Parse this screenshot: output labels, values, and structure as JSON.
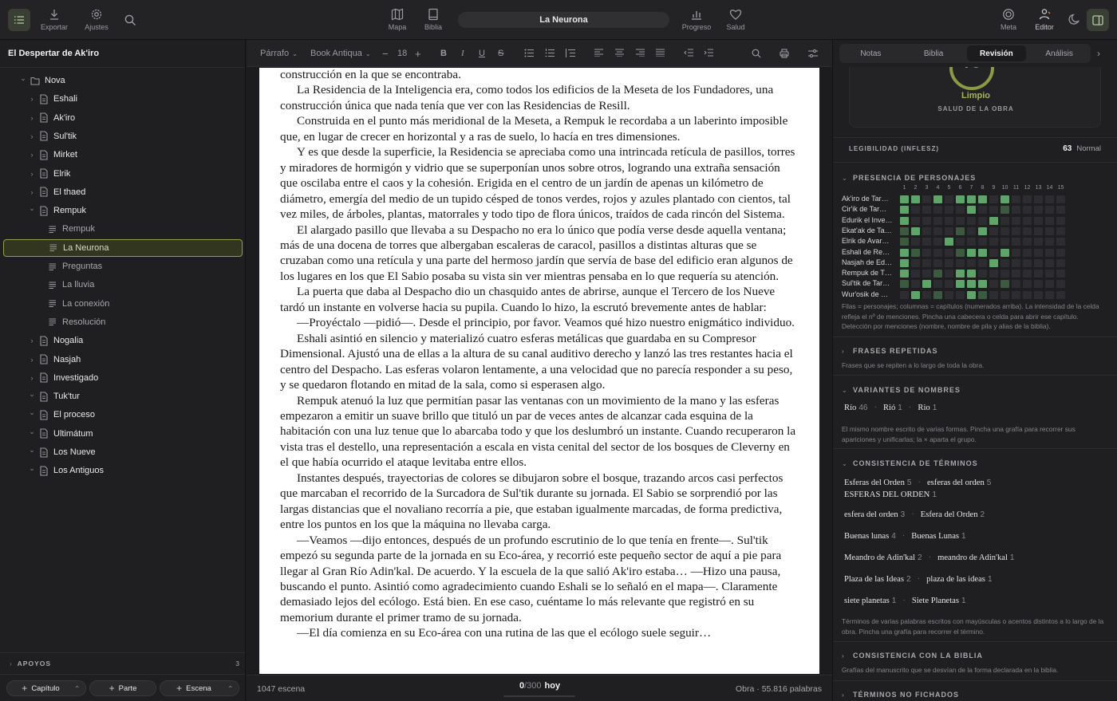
{
  "topbar": {
    "export_label": "Exportar",
    "settings_label": "Ajustes",
    "map_label": "Mapa",
    "bible_label": "Biblia",
    "doc_title": "La Neurona",
    "progress_label": "Progreso",
    "health_label": "Salud",
    "goal_label": "Meta",
    "editor_label": "Editor"
  },
  "sidebar": {
    "project_title": "El Despertar de Ak'iro",
    "tree": [
      {
        "label": "Nova",
        "level": 0,
        "type": "folder",
        "expanded": true
      },
      {
        "label": "Eshali",
        "level": 1,
        "type": "doc",
        "expanded": false
      },
      {
        "label": "Ak'iro",
        "level": 1,
        "type": "doc",
        "expanded": false
      },
      {
        "label": "Sul'tik",
        "level": 1,
        "type": "doc",
        "expanded": false
      },
      {
        "label": "Mirket",
        "level": 1,
        "type": "doc",
        "expanded": false
      },
      {
        "label": "Elrik",
        "level": 1,
        "type": "doc",
        "expanded": false
      },
      {
        "label": "El thaed",
        "level": 1,
        "type": "doc",
        "expanded": false
      },
      {
        "label": "Rempuk",
        "level": 1,
        "type": "doc",
        "expanded": true
      },
      {
        "label": "Rempuk",
        "level": 2,
        "type": "scene"
      },
      {
        "label": "La Neurona",
        "level": 2,
        "type": "scene",
        "selected": true
      },
      {
        "label": "Preguntas",
        "level": 2,
        "type": "scene"
      },
      {
        "label": "La lluvia",
        "level": 2,
        "type": "scene"
      },
      {
        "label": "La conexión",
        "level": 2,
        "type": "scene"
      },
      {
        "label": "Resolución",
        "level": 2,
        "type": "scene"
      },
      {
        "label": "Nogalia",
        "level": 1,
        "type": "doc",
        "expanded": false
      },
      {
        "label": "Nasjah",
        "level": 1,
        "type": "doc",
        "expanded": false
      },
      {
        "label": "Investigado",
        "level": 1,
        "type": "doc",
        "expanded": false
      },
      {
        "label": "Tuk'tur",
        "level": 1,
        "type": "doc",
        "expanded": true
      },
      {
        "label": "El proceso",
        "level": 1,
        "type": "doc",
        "expanded": true
      },
      {
        "label": "Ultimátum",
        "level": 1,
        "type": "doc",
        "expanded": true
      },
      {
        "label": "Los Nueve",
        "level": 1,
        "type": "doc",
        "expanded": true
      },
      {
        "label": "Los Antiguos",
        "level": 1,
        "type": "doc",
        "expanded": true
      }
    ],
    "apoyos_label": "APOYOS",
    "apoyos_count": "3",
    "btn_chapter": "Capítulo",
    "btn_part": "Parte",
    "btn_scene": "Escena"
  },
  "toolbar": {
    "paragraph_style": "Párrafo",
    "font_name": "Book Antiqua",
    "font_size": "18",
    "bold": "B",
    "italic": "I",
    "underline": "U",
    "strike": "S"
  },
  "editor": {
    "paragraphs": [
      {
        "text": "construcción en la que se encontraba.",
        "indent": false
      },
      {
        "text": "La Residencia de la Inteligencia era, como todos los edificios de la Meseta de los Fundadores, una construcción única que nada tenía que ver con las Residencias de Resill.",
        "indent": true
      },
      {
        "text": "Construida en el punto más meridional de la Meseta, a Rempuk le recordaba a un laberinto imposible que, en lugar de crecer en horizontal y a ras de suelo, lo hacía en tres dimensiones.",
        "indent": true
      },
      {
        "text": "Y es que desde la superficie, la Residencia se apreciaba como una intrincada retícula de pasillos, torres y miradores de hormigón y vidrio que se superponían unos sobre otros, logrando una extraña sensación que oscilaba entre el caos y la cohesión. Erigida en el centro de un jardín de apenas un kilómetro de diámetro, emergía del medio de un tupido césped de tonos verdes, rojos y azules plantado con cientos, tal vez miles, de árboles, plantas, matorrales y todo tipo de flora únicos, traídos de cada rincón del Sistema.",
        "indent": true
      },
      {
        "text": "El alargado pasillo que llevaba a su Despacho no era lo único que podía verse desde aquella ventana; más de una docena de torres que albergaban escaleras de caracol, pasillos a distintas alturas que se cruzaban como una retícula y una parte del hermoso jardín que servía de base del edificio eran algunos de los lugares en los que El Sabio posaba su vista sin ver mientras pensaba en lo que requería su atención.",
        "indent": true
      },
      {
        "text": "La puerta que daba al Despacho dio un chasquido antes de abrirse, aunque el Tercero de los Nueve tardó un instante en volverse hacia su pupila. Cuando lo hizo, la escrutó brevemente antes de hablar:",
        "indent": true
      },
      {
        "text": "—Proyéctalo —pidió—. Desde el principio, por favor. Veamos qué hizo nuestro enigmático individuo.",
        "indent": true
      },
      {
        "text": "Eshali asintió en silencio y materializó cuatro esferas metálicas que guardaba en su Compresor Dimensional. Ajustó una de ellas a la altura de su canal auditivo derecho y lanzó las tres restantes hacia el centro del Despacho. Las esferas volaron lentamente, a una velocidad que no parecía responder a su peso, y se quedaron flotando en mitad de la sala, como si esperasen algo.",
        "indent": true
      },
      {
        "text": "Rempuk atenuó la luz que permitían pasar las ventanas con un movimiento de la mano y las esferas empezaron a emitir un suave brillo que tituló un par de veces antes de alcanzar cada esquina de la habitación con una luz tenue que lo abarcaba todo y que los deslumbró un instante. Cuando recuperaron la vista tras el destello, una representación a escala en vista cenital del sector de los bosques de Cleverny en el que había ocurrido el ataque levitaba entre ellos.",
        "indent": true
      },
      {
        "text": "Instantes después, trayectorias de colores se dibujaron sobre el bosque, trazando arcos casi perfectos que marcaban el recorrido de la Surcadora de Sul'tik durante su jornada. El Sabio se sorprendió por las largas distancias que el novaliano recorría a pie, que estaban igualmente marcadas, de forma predictiva, entre los puntos en los que la máquina no llevaba carga.",
        "indent": true
      },
      {
        "text": "—Veamos —dijo entonces, después de un profundo escrutinio de lo que tenía en frente—. Sul'tik empezó su segunda parte de la jornada en su Eco-área, y recorrió este pequeño sector de aquí a pie para llegar al Gran Río Adin'kal. De acuerdo. Y la escuela de la que salió Ak'iro estaba… —Hizo una pausa, buscando el punto. Asintió como agradecimiento cuando Eshali se lo señaló en el mapa—. Claramente demasiado lejos del ecólogo. Está bien. En ese caso, cuéntame lo más relevante que registró en su memorium durante el primer tramo de su jornada.",
        "indent": true
      },
      {
        "text": "—El día comienza en su Eco-área con una rutina de las que el ecólogo suele seguir…",
        "indent": true
      }
    ]
  },
  "status": {
    "scene_words": "1047 escena",
    "goal_count": "0",
    "goal_total": "/300",
    "goal_today": "hoy",
    "work_words": "Obra · 55.816 palabras"
  },
  "right": {
    "tabs": [
      "Notas",
      "Biblia",
      "Revisión",
      "Análisis"
    ],
    "active_tab": 2,
    "health_score": "76",
    "health_score_value": 76,
    "health_status": "Limpio",
    "health_caption": "SALUD DE LA OBRA",
    "legibility_label": "LEGIBILIDAD (INFLESZ)",
    "legibility_value": "63",
    "legibility_level": "Normal",
    "presence_title": "PRESENCIA DE PERSONAJES",
    "chapters": [
      "1",
      "2",
      "3",
      "4",
      "5",
      "6",
      "7",
      "8",
      "9",
      "10",
      "11",
      "12",
      "13",
      "14",
      "15"
    ],
    "characters": [
      {
        "name": "Ak'iro de Tar…",
        "levels": [
          3,
          3,
          0,
          3,
          0,
          3,
          3,
          3,
          0,
          3,
          0,
          0,
          0,
          0,
          0
        ]
      },
      {
        "name": "Cir'ik de Tar…",
        "levels": [
          3,
          0,
          0,
          0,
          0,
          0,
          3,
          0,
          0,
          1,
          0,
          0,
          0,
          0,
          0
        ]
      },
      {
        "name": "Edurik el Inve…",
        "levels": [
          3,
          0,
          0,
          0,
          0,
          0,
          0,
          0,
          3,
          0,
          0,
          0,
          0,
          0,
          0
        ]
      },
      {
        "name": "Ekat'ak de Ta…",
        "levels": [
          1,
          3,
          0,
          0,
          0,
          1,
          0,
          3,
          0,
          0,
          0,
          0,
          0,
          0,
          0
        ]
      },
      {
        "name": "Elrik de Avar…",
        "levels": [
          1,
          0,
          0,
          0,
          3,
          0,
          0,
          0,
          0,
          0,
          0,
          0,
          0,
          0,
          0
        ]
      },
      {
        "name": "Eshali de Re…",
        "levels": [
          3,
          1,
          0,
          0,
          0,
          1,
          3,
          3,
          0,
          3,
          0,
          0,
          0,
          0,
          0
        ]
      },
      {
        "name": "Nasjah de Ed…",
        "levels": [
          3,
          0,
          0,
          0,
          0,
          0,
          0,
          0,
          3,
          0,
          0,
          0,
          0,
          0,
          0
        ]
      },
      {
        "name": "Rempuk de T…",
        "levels": [
          3,
          0,
          0,
          1,
          0,
          3,
          3,
          0,
          0,
          0,
          0,
          0,
          0,
          0,
          0
        ]
      },
      {
        "name": "Sul'tik de Tar…",
        "levels": [
          1,
          0,
          3,
          0,
          0,
          3,
          3,
          3,
          0,
          1,
          0,
          0,
          0,
          0,
          0
        ]
      },
      {
        "name": "Wur'osik de …",
        "levels": [
          0,
          3,
          0,
          1,
          0,
          0,
          3,
          1,
          0,
          0,
          0,
          0,
          0,
          0,
          0
        ]
      }
    ],
    "presence_note": "Filas = personajes; columnas = capítulos (numerados arriba). La intensidad de la celda refleja el nº de menciones. Pincha una cabecera o celda para abrir ese capítulo. Detección por menciones (nombre, nombre de pila y alias de la biblia).",
    "repeated_title": "FRASES REPETIDAS",
    "repeated_note": "Frases que se repiten a lo largo de toda la obra.",
    "variants_title": "VARIANTES DE NOMBRES",
    "variants": [
      {
        "t": "Río",
        "c": "46"
      },
      {
        "t": "Rió",
        "c": "1"
      },
      {
        "t": "Rio",
        "c": "1"
      }
    ],
    "variants_note": "El mismo nombre escrito de varias formas. Pincha una grafía para recorrer sus apariciones y unificarlas; la × aparta el grupo.",
    "consistency_title": "CONSISTENCIA DE TÉRMINOS",
    "terms": [
      [
        {
          "t": "Esferas del Orden",
          "c": "5"
        },
        {
          "t": "esferas del orden",
          "c": "5"
        },
        {
          "t": "ESFERAS DEL ORDEN",
          "c": "1"
        }
      ],
      [
        {
          "t": "esfera del orden",
          "c": "3"
        },
        {
          "t": "Esfera del Orden",
          "c": "2"
        }
      ],
      [
        {
          "t": "Buenas lunas",
          "c": "4"
        },
        {
          "t": "Buenas Lunas",
          "c": "1"
        }
      ],
      [
        {
          "t": "Meandro de Adin'kal",
          "c": "2"
        },
        {
          "t": "meandro de Adin'kal",
          "c": "1"
        }
      ],
      [
        {
          "t": "Plaza de las Ideas",
          "c": "2"
        },
        {
          "t": "plaza de las ideas",
          "c": "1"
        }
      ],
      [
        {
          "t": "siete planetas",
          "c": "1"
        },
        {
          "t": "Siete Planetas",
          "c": "1"
        }
      ]
    ],
    "consistency_note": "Términos de varias palabras escritos con mayúsculas o acentos distintos a lo largo de la obra. Pincha una grafía para recorrer el término.",
    "bible_title": "CONSISTENCIA CON LA BIBLIA",
    "bible_note": "Grafías del manuscrito que se desvían de la forma declarada en la biblia.",
    "unfiled_title": "TÉRMINOS NO FICHADOS"
  },
  "colors": {
    "accent": "#6fae72",
    "cell_strong": "#5fa56a",
    "cell_weak": "#3b5a40",
    "cell_empty": "#2d2d31",
    "selected_border": "#8fa04a"
  }
}
